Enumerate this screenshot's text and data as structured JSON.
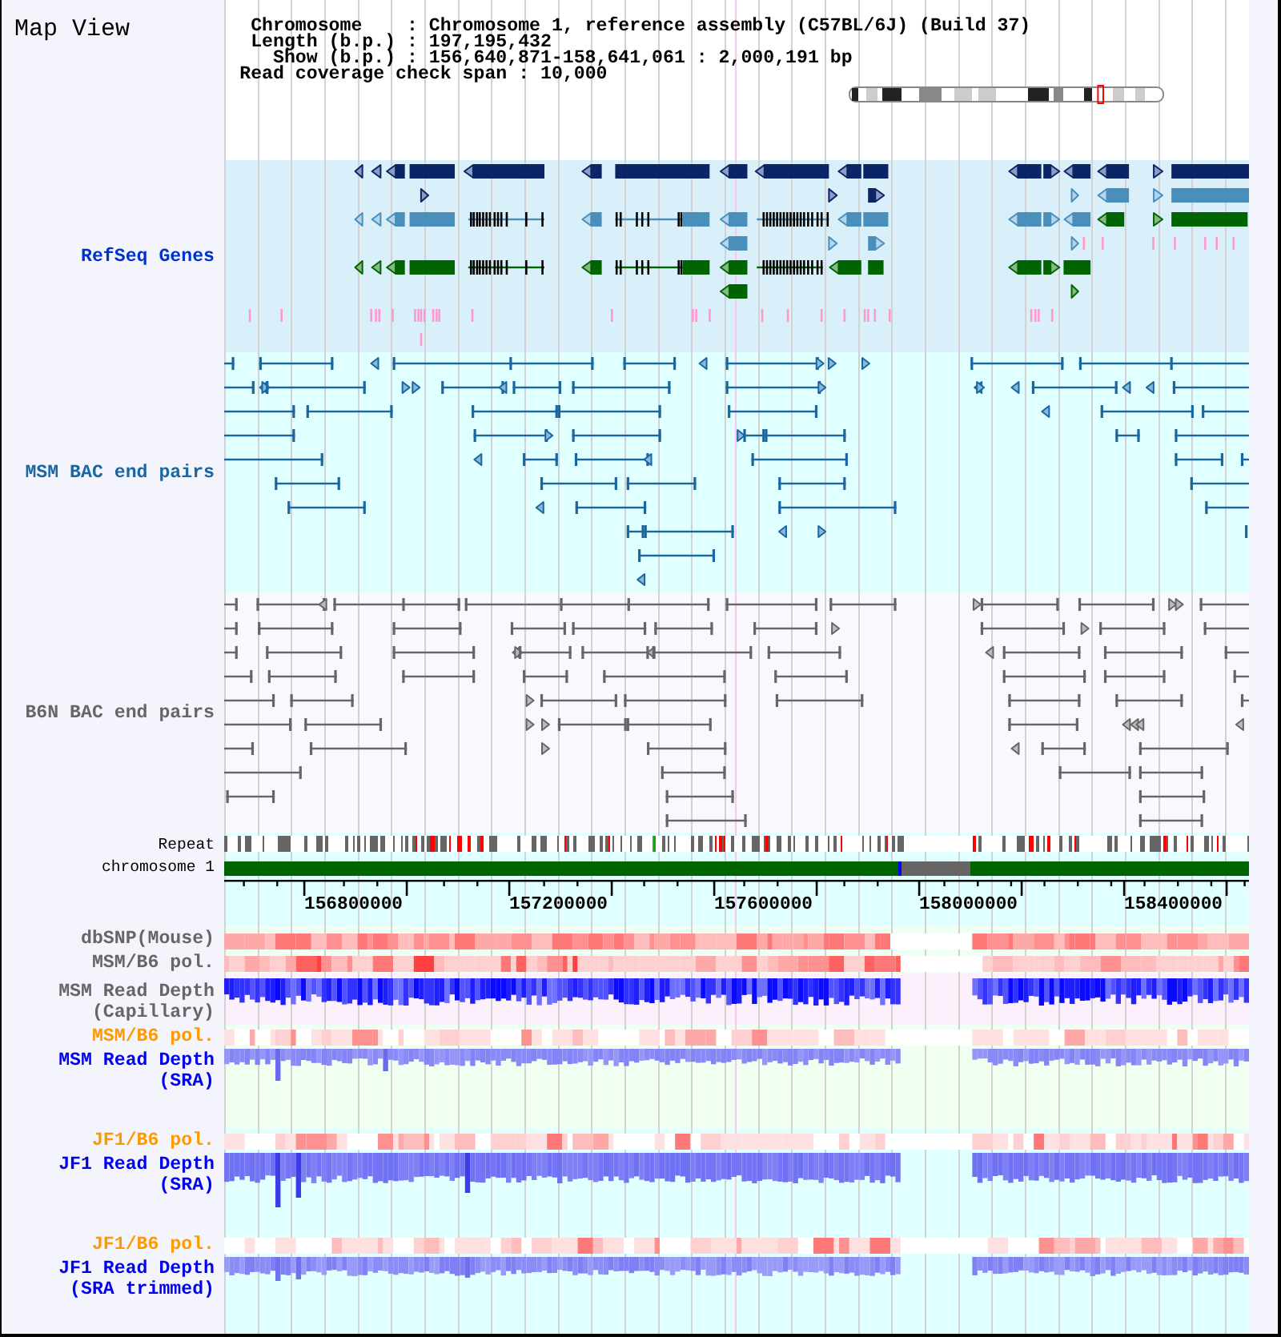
{
  "title": "Map View",
  "info_lines": [
    "Chromosome    : Chromosome 1, reference assembly (C57BL/6J) (Build 37)",
    "Length (b.p.) : 197,195,432",
    "Show (b.p.) : 156,640,871-158,641,061 : 2,000,191 bp",
    "Read coverage check span : 10,000"
  ],
  "tracks": [
    {
      "label": "RefSeq Genes",
      "kind": "genes",
      "color": "#0033cc"
    },
    {
      "label": "MSM BAC end pairs",
      "kind": "bacpairs",
      "color": "#1a66a0"
    },
    {
      "label": "B6N BAC end pairs",
      "kind": "bacpairs",
      "color": "#666666"
    },
    {
      "label": "Repeat",
      "kind": "repeat",
      "color": "#000000"
    },
    {
      "label": "chromosome 1",
      "kind": "chromosome",
      "color": "#000000"
    },
    {
      "kind": "ruler",
      "ticks": [
        "156800000",
        "157200000",
        "157600000",
        "158000000",
        "158400000"
      ]
    },
    {
      "label": "dbSNP(Mouse)",
      "kind": "snp",
      "color": "#666666"
    },
    {
      "label": "MSM/B6 pol.",
      "kind": "polymorphism",
      "color": "#666666"
    },
    {
      "label": "MSM Read Depth (Capillary)",
      "kind": "capillary",
      "color": "#666666"
    },
    {
      "label": "MSM/B6 pol.",
      "kind": "polymorphism",
      "color": "#ff9900"
    },
    {
      "label": "MSM Read Depth (SRA)",
      "kind": "sra",
      "color": "#0000ee"
    },
    {
      "label": "JF1/B6 pol.",
      "kind": "polymorphism",
      "color": "#ff9900"
    },
    {
      "label": "JF1 Read Depth (SRA)",
      "kind": "sra",
      "color": "#0000ee"
    },
    {
      "label": "JF1/B6 pol.",
      "kind": "polymorphism",
      "color": "#ff9900"
    },
    {
      "label": "JF1 Read Depth (SRA trimmed)",
      "kind": "sra",
      "color": "#0000ee"
    }
  ]
}
